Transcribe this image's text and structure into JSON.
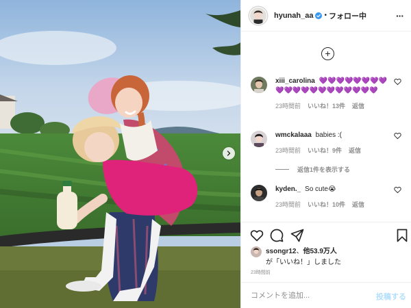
{
  "post": {
    "photo_alt": "",
    "carousel_next_icon": "chevron-right-icon"
  },
  "header": {
    "username": "hyunah_aa",
    "separator": "•",
    "follow_label": "フォロー中",
    "verified_icon": "verified-badge-icon",
    "more_icon": "more-options-icon",
    "more_glyph": "···"
  },
  "load_more": {
    "glyph": "+"
  },
  "comments": [
    {
      "username": "xiii_carolina",
      "text": "💜💜💜💜💜💜💜💜💜💜💜💜💜💜💜💜💜💜💜💜",
      "time": "23時間前",
      "likes": "いいね！13件",
      "reply": "返信"
    },
    {
      "username": "wmckalaaa",
      "text": "babies :(",
      "time": "23時間前",
      "likes": "いいね！9件",
      "reply": "返信"
    },
    {
      "username": "kyden._",
      "text": "So cute😭",
      "time": "23時間前",
      "likes": "いいね！10件",
      "reply": "返信"
    }
  ],
  "view_replies": "返信1件を表示する",
  "liked_by": {
    "user": "ssongr12",
    "others": "他53.9万人",
    "suffix": "が「いいね！」しました",
    "prefix_sep": "、"
  },
  "post_time": "23時間前",
  "add_comment": {
    "placeholder": "コメントを追加...",
    "post_label": "投稿する"
  },
  "colors": {
    "accent_blue": "#0095f6",
    "post_button_disabled": "#b2dffc",
    "verified": "#3897f0",
    "border": "#efefef",
    "secondary_text": "#8e8e8e"
  }
}
